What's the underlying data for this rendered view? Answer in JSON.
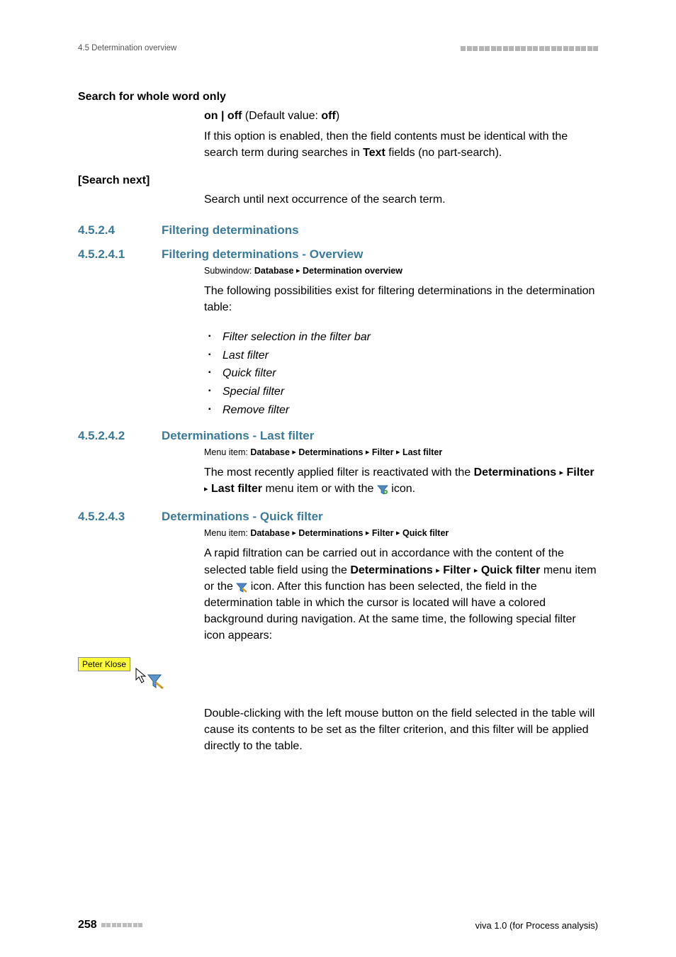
{
  "header": {
    "section_ref": "4.5 Determination overview"
  },
  "opt1": {
    "title": "Search for whole word only",
    "value_line_a": "on | off",
    "value_line_b": " (Default value: ",
    "value_line_c": "off",
    "value_line_d": ")",
    "desc_a": "If this option is enabled, then the field contents must be identical with the search term during searches in ",
    "desc_b": "Text",
    "desc_c": " fields (no part-search)."
  },
  "opt2": {
    "title": "[Search next]",
    "desc": "Search until next occurrence of the search term."
  },
  "sec_4524": {
    "num": "4.5.2.4",
    "title": "Filtering determinations"
  },
  "sec_45241": {
    "num": "4.5.2.4.1",
    "title": "Filtering determinations - Overview",
    "subwindow_a": "Subwindow: ",
    "subwindow_b": "Database",
    "subwindow_c": "Determination overview",
    "intro": "The following possibilities exist for filtering determinations in the determination table:",
    "items": [
      "Filter selection in the filter bar",
      "Last filter",
      "Quick filter",
      "Special filter",
      "Remove filter"
    ]
  },
  "sec_45242": {
    "num": "4.5.2.4.2",
    "title": "Determinations - Last filter",
    "menu_a": "Menu item: ",
    "menu_b": "Database",
    "menu_c": "Determinations",
    "menu_d": "Filter",
    "menu_e": "Last filter",
    "body_a": "The most recently applied filter is reactivated with the ",
    "body_b": "Determinations",
    "body_c": "Filter",
    "body_d": "Last filter",
    "body_e": " menu item or with the ",
    "body_f": " icon."
  },
  "sec_45243": {
    "num": "4.5.2.4.3",
    "title": "Determinations - Quick filter",
    "menu_a": "Menu item: ",
    "menu_b": "Database",
    "menu_c": "Determinations",
    "menu_d": "Filter",
    "menu_e": "Quick filter",
    "p1_a": "A rapid filtration can be carried out in accordance with the content of the selected table field using the ",
    "p1_b": "Determinations",
    "p1_c": "Filter",
    "p1_d": "Quick filter",
    "p1_e": " menu item or the ",
    "p1_f": " icon. After this function has been selected, the field in the determination table in which the cursor is located will have a colored background during navigation. At the same time, the following special filter icon appears:",
    "cell_text": "Peter Klose",
    "p2": "Double-clicking with the left mouse button on the field selected in the table will cause its contents to be set as the filter criterion, and this filter will be applied directly to the table."
  },
  "footer": {
    "page": "258",
    "product": "viva 1.0 (for Process analysis)"
  }
}
